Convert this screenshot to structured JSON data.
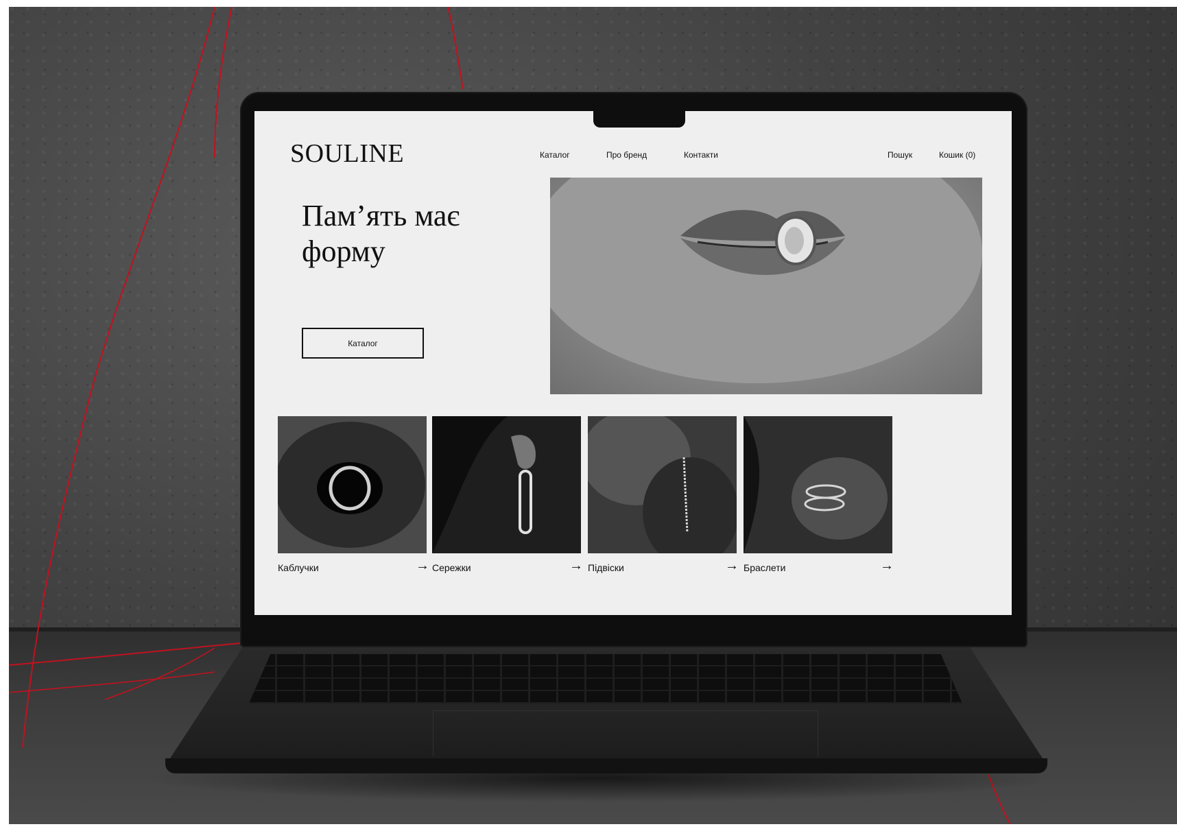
{
  "site": {
    "logo": "SOULINE",
    "nav": {
      "links": [
        "Каталог",
        "Про бренд",
        "Контакти"
      ],
      "search": "Пошук",
      "cart": "Кошик (0)"
    },
    "hero": {
      "title": "Пам’ять має форму",
      "button": "Каталог"
    },
    "categories": [
      {
        "label": "Каблучки",
        "arrow": "→"
      },
      {
        "label": "Сережки",
        "arrow": "→"
      },
      {
        "label": "Підвіски",
        "arrow": "→"
      },
      {
        "label": "Браслети",
        "arrow": "→"
      }
    ]
  },
  "colors": {
    "screen_bg": "#efefef",
    "text": "#111111",
    "thread": "#c1121f"
  }
}
